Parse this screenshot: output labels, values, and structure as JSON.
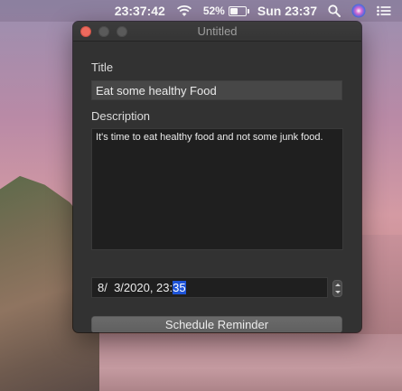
{
  "menubar": {
    "clock": "23:37:42",
    "battery_percent": "52%",
    "battery_level": 0.52,
    "datetime": "Sun 23:37",
    "icons": [
      "wifi-icon",
      "battery-icon",
      "search-icon",
      "siri-icon",
      "notification-center-icon"
    ]
  },
  "window": {
    "title": "Untitled",
    "title_label": "Title",
    "title_value": "Eat some healthy Food",
    "description_label": "Description",
    "description_value": "It's time to eat healthy food and not some junk food.",
    "date_prefix": "8/  3/2020, 23:",
    "date_minutes": "35",
    "button_label": "Schedule Reminder"
  },
  "colors": {
    "close_button": "#ed6a5e",
    "window_bg": "#323232",
    "selection": "#1e54d8"
  }
}
